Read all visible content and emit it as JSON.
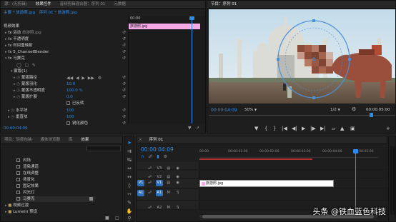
{
  "effect_controls": {
    "tabs": [
      "源：(无剪辑)",
      "效果控件",
      "音频剪辑混合器：序列 01",
      "元数据"
    ],
    "source_tabs": [
      "主要 * 旅游照.jpg",
      "序列 01 * 旅游照.jpg"
    ],
    "clip_time": "00:00",
    "clip_name": "旅游照.jpg",
    "section_header": "视频效果",
    "effects": [
      {
        "name": "运动",
        "suffix": "旅游照.jpg"
      },
      {
        "name": "不透明度"
      },
      {
        "name": "时间重映射"
      },
      {
        "name": "5_ChannelBlender"
      },
      {
        "name": "马赛克"
      }
    ],
    "mask_name": "蒙版(1)",
    "mask_props": [
      {
        "name": "蒙版路径",
        "value": ""
      },
      {
        "name": "蒙版羽化",
        "value": "10.0"
      },
      {
        "name": "蒙版不透明度",
        "value": "100.0 %"
      },
      {
        "name": "蒙版扩展",
        "value": "0.0"
      }
    ],
    "inverted_label": "已反转",
    "horizontal_blocks": {
      "name": "水平块",
      "value": "100"
    },
    "vertical_blocks": {
      "name": "垂直块",
      "value": "100"
    },
    "sharp_colors": "锐化颜色",
    "footer_time": "00:00:04:09"
  },
  "program_monitor": {
    "title": "节目：序列 01",
    "timecode": "00:00:04:09",
    "zoom": "50%",
    "resolution": "1/2",
    "duration": "00:00:05:00"
  },
  "project_panel": {
    "tabs": [
      "项目：轻度包装 ",
      "媒体浏览器",
      "库",
      "效果"
    ],
    "items": [
      "闪烁",
      "渲染通道",
      "在线调整",
      "场景化",
      "固定效果",
      "闪光灯",
      "马赛克"
    ],
    "folders": [
      "视频过渡",
      "Lumetri 预设"
    ]
  },
  "timeline": {
    "tab": "序列 01",
    "timecode": "00:00:04:09",
    "ruler": [
      "00:00",
      "00:00:01:00",
      "00:00:02:00",
      "00:00:03:00",
      "00:00:04:00",
      "00:00:05:00"
    ],
    "tracks": [
      {
        "id": "V3",
        "target": ""
      },
      {
        "id": "V2",
        "target": ""
      },
      {
        "id": "V1",
        "target": "V1"
      },
      {
        "id": "A1",
        "target": "A1"
      },
      {
        "id": "A2",
        "target": ""
      }
    ],
    "clip_label": "旅游照.jpg",
    "playhead_fraction": 0.872
  },
  "watermark": "头条 @铁血蓝色科技",
  "colors": {
    "accent": "#2d8ceb",
    "clip": "#ffffff",
    "clip_pink": "#f6a9e6",
    "bg": "#1e1e1e"
  }
}
